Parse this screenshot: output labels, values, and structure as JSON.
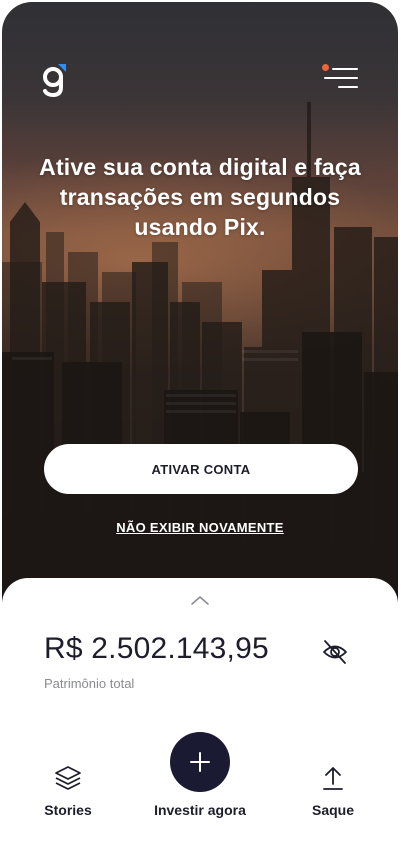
{
  "hero": {
    "headline": "Ative sua conta digital e faça transações em segundos usando Pix.",
    "activate_button": "ATIVAR CONTA",
    "hide_link": "NÃO EXIBIR NOVAMENTE"
  },
  "summary": {
    "balance": "R$ 2.502.143,95",
    "balance_label": "Patrimônio total"
  },
  "actions": {
    "stories": "Stories",
    "invest": "Investir agora",
    "withdraw": "Saque"
  },
  "colors": {
    "primary_dark": "#1a1a33",
    "accent_orange": "#f0643c",
    "logo_blue": "#2f8ff0",
    "text_dark": "#1d1d2b",
    "text_muted": "#8a8a93"
  },
  "icons": [
    "brand-logo-icon",
    "menu-icon",
    "notification-dot-icon",
    "chevron-up-icon",
    "eye-off-icon",
    "layers-icon",
    "plus-icon",
    "upload-arrow-icon"
  ]
}
